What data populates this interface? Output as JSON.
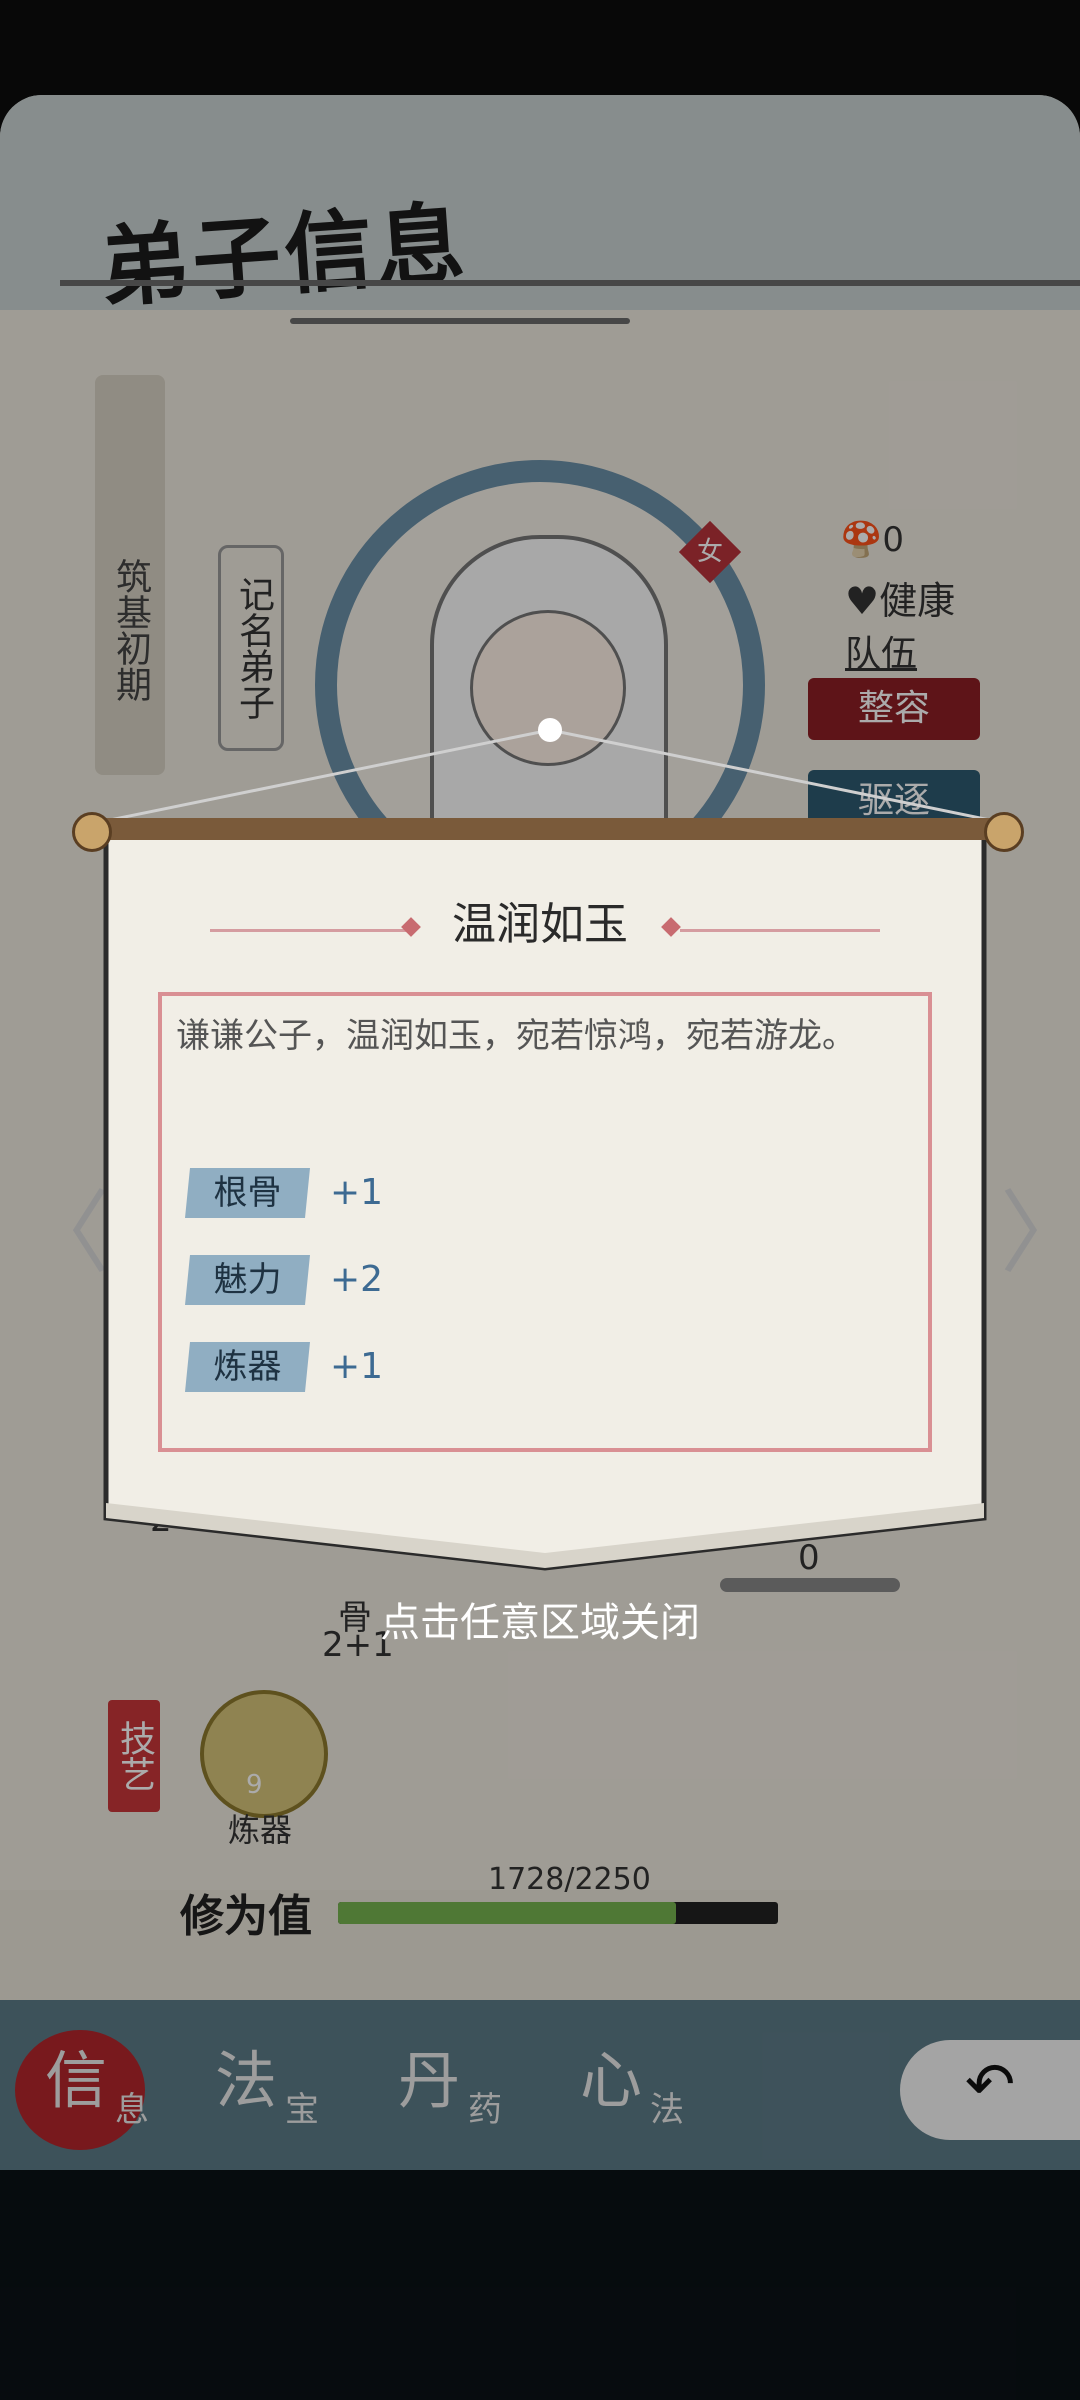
{
  "screen": {
    "title": "弟子信息",
    "realm": "筑基初期",
    "rank": "记名弟子",
    "gender": "女",
    "stats": {
      "zero_count": "0",
      "health": "健康",
      "team": "队伍"
    },
    "buttons": {
      "rebuild": "整容",
      "expel": "驱逐"
    },
    "arrows": {
      "left": "〈",
      "right": "〉"
    },
    "bg_values": {
      "left_value": "2",
      "bone_label": "骨",
      "bone_value": "2+1",
      "right_value": "0"
    },
    "skill": {
      "section_label": "技艺",
      "level": "9",
      "name": "炼器"
    },
    "xp": {
      "label": "修为值",
      "value": "1728/2250",
      "current": 1728,
      "max": 2250
    },
    "tabs": [
      {
        "big": "信",
        "small": "息"
      },
      {
        "big": "法",
        "small": "宝"
      },
      {
        "big": "丹",
        "small": "药"
      },
      {
        "big": "心",
        "small": "法"
      }
    ],
    "back_icon": "↶"
  },
  "popup": {
    "title": "温润如玉",
    "description": "谦谦公子，温润如玉，宛若惊鸿，宛若游龙。",
    "attributes": [
      {
        "name": "根骨",
        "value": "+1"
      },
      {
        "name": "魅力",
        "value": "+2"
      },
      {
        "name": "炼器",
        "value": "+1"
      }
    ],
    "close_hint": "点击任意区域关闭"
  },
  "colors": {
    "accent_red": "#b3262c",
    "attribute_tag": "#90aec2",
    "attribute_value": "#3d6a92",
    "desc_border": "#d98f93"
  }
}
